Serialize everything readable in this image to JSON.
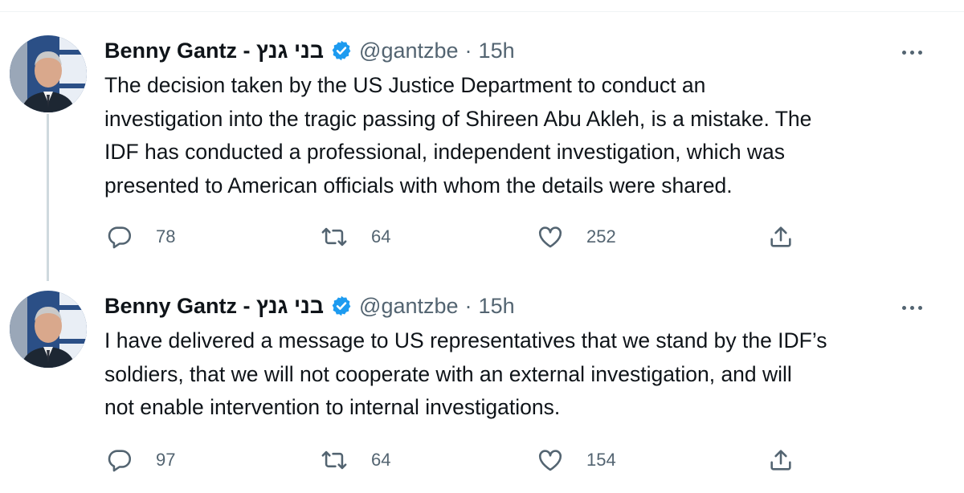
{
  "tweets": [
    {
      "author_name": "Benny Gantz - בני גנץ",
      "handle": "@gantzbe",
      "separator": "·",
      "time": "15h",
      "text_lines": [
        "The decision taken by the US Justice Department to conduct an",
        "investigation into the tragic passing of Shireen Abu Akleh, is a mistake. The",
        "IDF has conducted a professional, independent investigation, which was",
        "presented to American officials with whom the details were shared."
      ],
      "replies": "78",
      "retweets": "64",
      "likes": "252"
    },
    {
      "author_name": "Benny Gantz - בני גנץ",
      "handle": "@gantzbe",
      "separator": "·",
      "time": "15h",
      "text_lines": [
        "I have delivered a message to US representatives that we stand by the IDF’s",
        "soldiers, that we will not cooperate with an external investigation, and will",
        "not enable intervention to internal investigations."
      ],
      "replies": "97",
      "retweets": "64",
      "likes": "154"
    }
  ],
  "icons": {
    "verified": "verified-badge-icon",
    "more": "more-options-icon",
    "reply": "reply-icon",
    "retweet": "retweet-icon",
    "like": "like-icon",
    "share": "share-icon"
  },
  "colors": {
    "verified_blue": "#1d9bf0",
    "muted_text": "#536471",
    "text": "#0f1419",
    "thread_line": "#cfd9de"
  }
}
